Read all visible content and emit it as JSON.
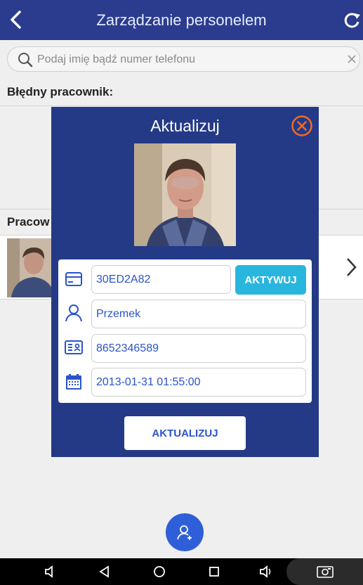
{
  "header": {
    "title": "Zarządzanie personelem",
    "back_icon": "chevron-left-icon",
    "refresh_icon": "refresh-icon",
    "color": "#2b3c8f"
  },
  "search": {
    "placeholder": "Podaj imię bądź numer telefonu",
    "value": ""
  },
  "sections": {
    "invalid_label": "Błędny pracownik:",
    "employees_label": "Pracow"
  },
  "modal": {
    "title": "Aktualizuj",
    "card_id": "30ED2A82",
    "activate_label": "AKTYWUJ",
    "name": "Przemek",
    "phone": "8652346589",
    "date": "2013-01-31 01:55:00",
    "update_label": "AKTUALIZUJ",
    "bg_color": "#243a86",
    "accent_color": "#29b6de",
    "close_color": "#f26b24"
  },
  "icons": {
    "card": "card-icon",
    "user": "user-icon",
    "id": "id-card-icon",
    "calendar": "calendar-icon",
    "fab": "add-user-icon"
  }
}
